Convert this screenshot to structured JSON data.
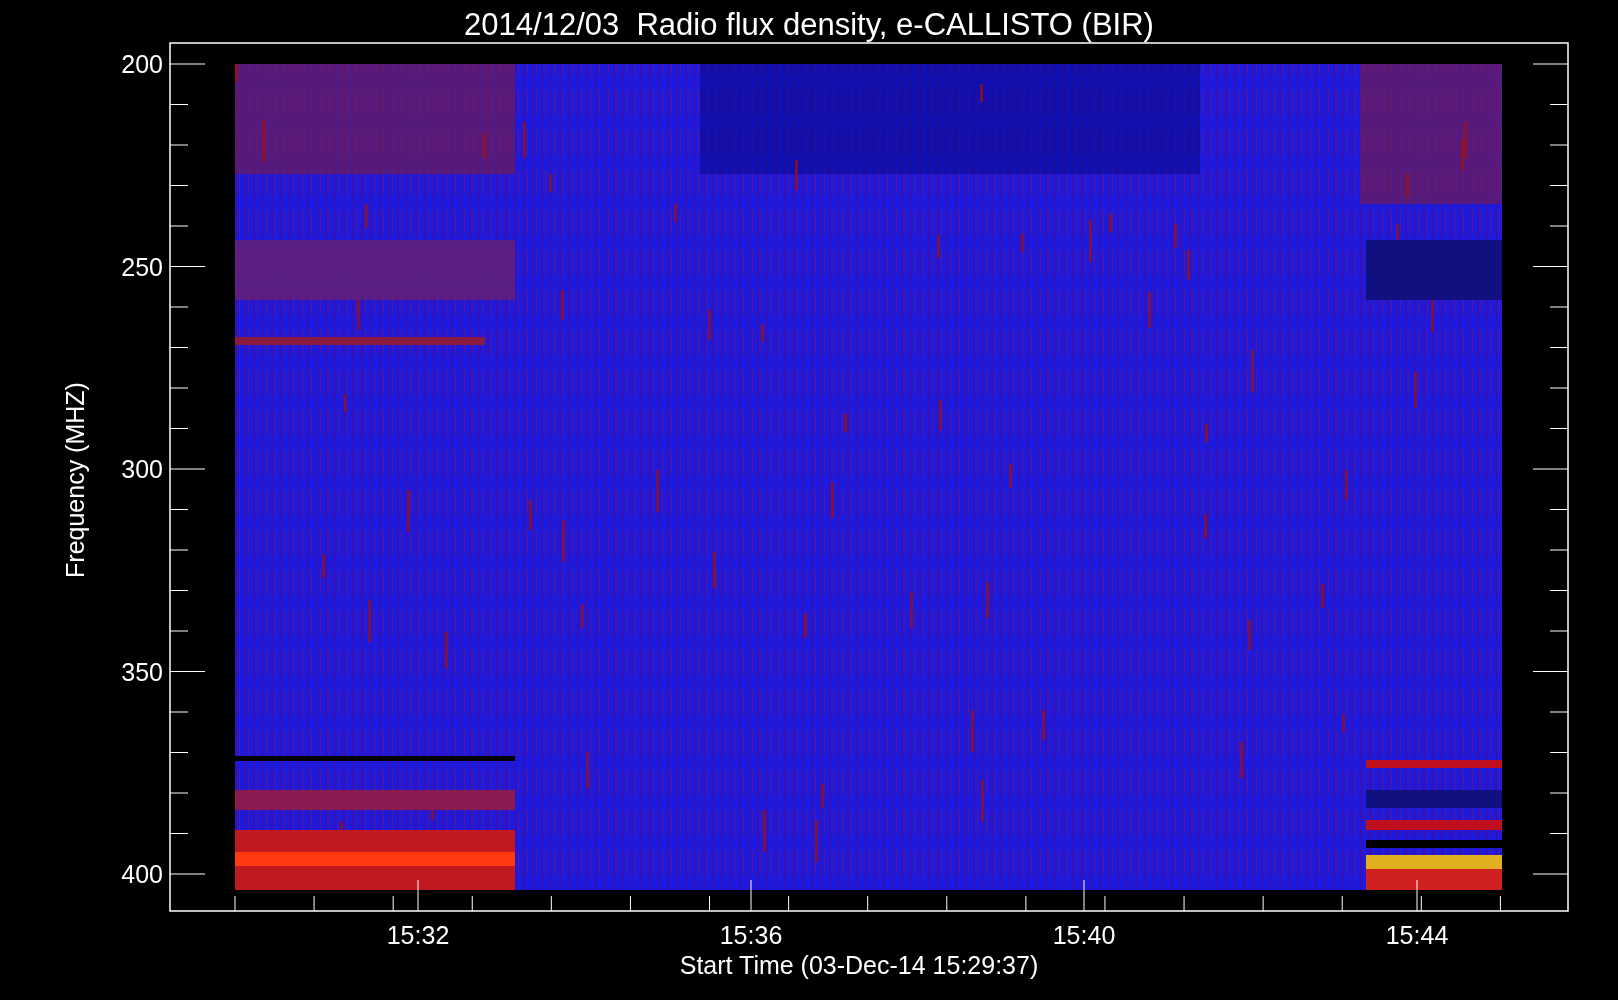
{
  "title": "2014/12/03  Radio flux density, e-CALLISTO (BIR)",
  "y_axis": {
    "label": "Frequency (MHZ)",
    "ticks": [
      "200",
      "250",
      "300",
      "350",
      "400"
    ]
  },
  "x_axis": {
    "label": "Start Time (03-Dec-14 15:29:37)",
    "ticks": [
      "15:32",
      "15:36",
      "15:40",
      "15:44"
    ]
  }
}
